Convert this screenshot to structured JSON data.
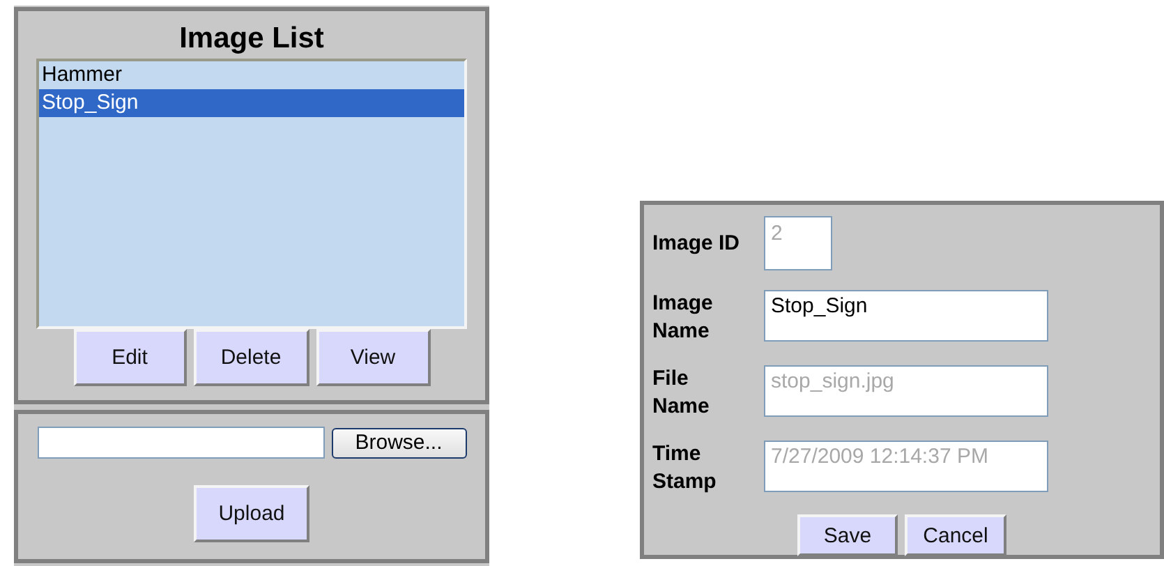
{
  "image_list": {
    "title": "Image List",
    "items": [
      {
        "label": "Hammer",
        "selected": false
      },
      {
        "label": "Stop_Sign",
        "selected": true
      }
    ],
    "buttons": [
      "Edit",
      "Delete",
      "View"
    ]
  },
  "upload": {
    "browse_button": "Browse...",
    "upload_button": "Upload"
  },
  "details": {
    "fields": [
      {
        "label": "Image ID",
        "value": "2",
        "disabled": true,
        "kind": "short"
      },
      {
        "label": "Image Name",
        "value": "Stop_Sign",
        "disabled": false,
        "kind": "wide"
      },
      {
        "label": "File Name",
        "value": "stop_sign.jpg",
        "disabled": true,
        "kind": "wide"
      },
      {
        "label": "Time Stamp",
        "value": "7/27/2009 12:14:37 PM",
        "disabled": true,
        "kind": "wide"
      }
    ],
    "buttons": [
      "Save",
      "Cancel"
    ]
  }
}
